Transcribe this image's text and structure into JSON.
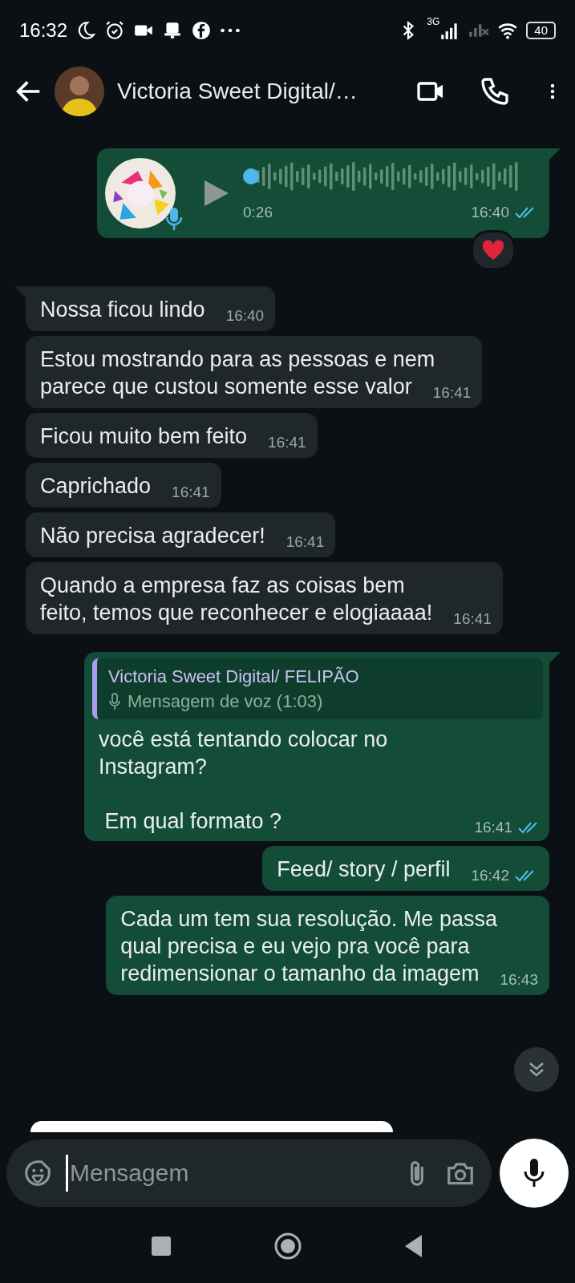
{
  "status_bar": {
    "time": "16:32",
    "network": "3G",
    "battery": "40"
  },
  "header": {
    "title": "Victoria Sweet Digital/…"
  },
  "messages": [
    {
      "kind": "voice",
      "outgoing": true,
      "tail": true,
      "duration": "0:26",
      "time": "16:40",
      "read": true,
      "reaction": true
    },
    {
      "kind": "text",
      "outgoing": false,
      "tail": true,
      "text": "Nossa ficou lindo",
      "time": "16:40"
    },
    {
      "kind": "text",
      "outgoing": false,
      "tail": false,
      "text": "Estou mostrando para as pessoas e nem\nparece que custou somente esse valor",
      "time": "16:41"
    },
    {
      "kind": "text",
      "outgoing": false,
      "tail": false,
      "text": "Ficou muito bem feito",
      "time": "16:41"
    },
    {
      "kind": "text",
      "outgoing": false,
      "tail": false,
      "text": "Caprichado",
      "time": "16:41"
    },
    {
      "kind": "text",
      "outgoing": false,
      "tail": false,
      "text": "Não precisa agradecer!",
      "time": "16:41"
    },
    {
      "kind": "text",
      "outgoing": false,
      "tail": false,
      "text": "Quando a empresa faz as coisas bem\nfeito, temos que reconhecer e elogiaaaa!",
      "time": "16:41"
    },
    {
      "kind": "quote",
      "outgoing": true,
      "tail": true,
      "quote_author": "Victoria Sweet Digital/ FELIPÃO",
      "quote_text": "Mensagem de voz (1:03)",
      "text": "você está tentando colocar no\nInstagram?\n\n Em qual formato ?",
      "time": "16:41",
      "read": true
    },
    {
      "kind": "text",
      "outgoing": true,
      "tail": false,
      "text": "Feed/ story / perfil",
      "time": "16:42",
      "read": true
    },
    {
      "kind": "text",
      "outgoing": true,
      "tail": false,
      "text": "Cada um tem sua resolução. Me passa\nqual precisa e eu vejo pra você para\nredimensionar o tamanho da imagem",
      "time": "16:43"
    }
  ],
  "composer": {
    "placeholder": "Mensagem"
  }
}
